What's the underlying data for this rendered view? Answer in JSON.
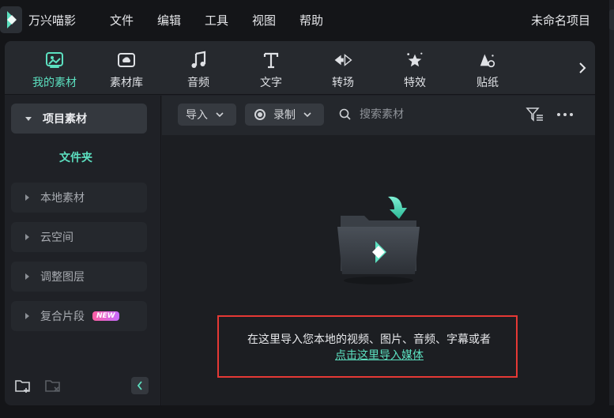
{
  "app": {
    "name": "万兴喵影",
    "project_name": "未命名项目"
  },
  "menu": [
    {
      "label": "文件"
    },
    {
      "label": "编辑"
    },
    {
      "label": "工具"
    },
    {
      "label": "视图"
    },
    {
      "label": "帮助"
    }
  ],
  "tabs": [
    {
      "label": "我的素材",
      "icon": "my-media-icon",
      "active": true
    },
    {
      "label": "素材库",
      "icon": "stock-library-icon"
    },
    {
      "label": "音频",
      "icon": "audio-note-icon"
    },
    {
      "label": "文字",
      "icon": "text-t-icon"
    },
    {
      "label": "转场",
      "icon": "transition-icon"
    },
    {
      "label": "特效",
      "icon": "effects-star-icon"
    },
    {
      "label": "贴纸",
      "icon": "sticker-icon"
    }
  ],
  "sidebar": {
    "project_media": "项目素材",
    "folder": "文件夹",
    "items": [
      {
        "label": "本地素材"
      },
      {
        "label": "云空间"
      },
      {
        "label": "调整图层"
      },
      {
        "label": "复合片段",
        "badge": "NEW"
      }
    ]
  },
  "toolbar": {
    "import_label": "导入",
    "record_label": "录制",
    "search_placeholder": "搜索素材"
  },
  "empty_state": {
    "message": "在这里导入您本地的视频、图片、音频、字幕或者",
    "link": "点击这里导入媒体"
  },
  "colors": {
    "accent": "#5ce0c0",
    "highlight_border": "#e53935",
    "panel_bg": "#1f2126"
  }
}
